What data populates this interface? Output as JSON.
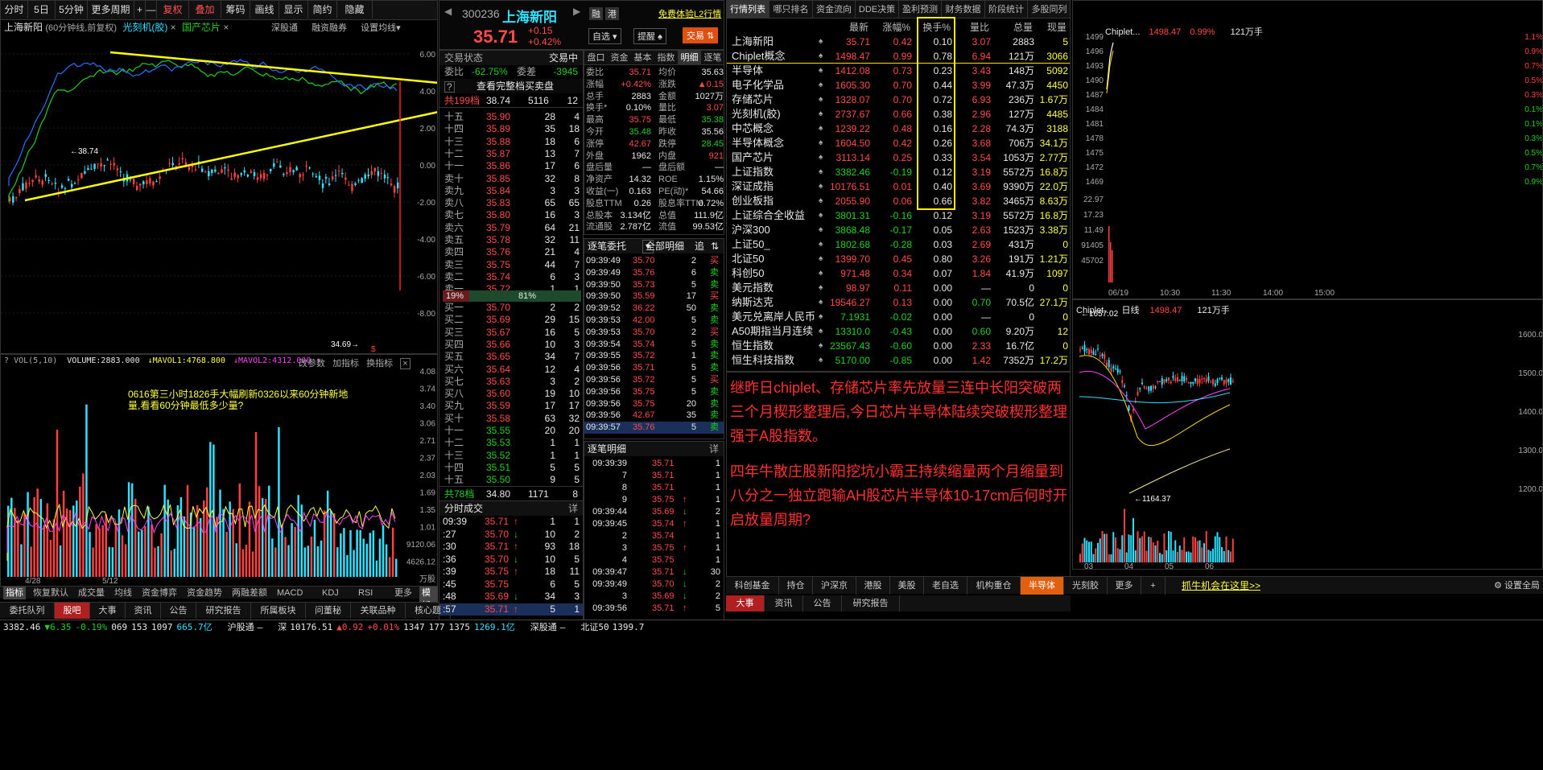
{
  "left_toolbar": {
    "items": [
      "分时",
      "5日",
      "5分钟",
      "更多周期",
      "+",
      "—",
      "复权",
      "叠加",
      "筹码",
      "画线",
      "显示",
      "简约",
      "隐藏"
    ]
  },
  "kline": {
    "stock_name": "上海新阳",
    "period_note": "(60分钟线,前复权)",
    "overlay1": "光刻机(胶)",
    "overlay2": "国产芯片",
    "actions": [
      "深股通",
      "融资融券",
      "设置均线"
    ],
    "y_axis_ticks": [
      "6.00",
      "4.00",
      "2.00",
      "0.00",
      "-2.00",
      "-4.00",
      "-6.00",
      "-8.00"
    ],
    "label_high": "38.74",
    "label_low": "34.69"
  },
  "volume": {
    "header_vol": "VOL(5,10)",
    "header_volume": "VOLUME:2883.000",
    "header_mavol1": "MAVOL1:4768.800",
    "header_mavol2": "MAVOL2:4312.000",
    "tools": [
      "改参数",
      "加指标",
      "换指标"
    ],
    "y_ticks": [
      "4.08",
      "3.74",
      "3.40",
      "3.06",
      "2.71",
      "2.37",
      "2.03",
      "1.69",
      "1.35",
      "1.01",
      "9120.06",
      "4626.12",
      "万股"
    ],
    "annotation": "0616第三小时1826手大幅刷新0326以来60分钟新地量,看看60分钟最低多少量?",
    "date1": "4/28",
    "date2": "5/12"
  },
  "left_bottom_tabs": [
    "指标",
    "恢复默认",
    "成交量",
    "均线",
    "资金博弈",
    "资金趋势",
    "两融差额",
    "MACD",
    "KDJ",
    "RSI",
    "更多",
    "模板"
  ],
  "quote": {
    "code": "300236",
    "name": "上海新阳",
    "price": "35.71",
    "change": "+0.15",
    "change_pct": "+0.42%",
    "badge1": "融",
    "badge2": "港",
    "l2_link": "免费体验L2行情",
    "btn_watch": "自选",
    "btn_alert": "提醒",
    "btn_trade": "交易",
    "status_label": "交易状态",
    "status_value": "交易中",
    "weibi_label": "委比",
    "weibi_value": "-62.75%",
    "weicha_label": "委差",
    "weicha_value": "-3945",
    "see_book": "查看完整档买卖盘",
    "sell_total_label": "共199档",
    "sell_total_price": "38.74",
    "sell_total_vol": "5116",
    "sell_total_cnt": "12",
    "ratio_left": "19%",
    "ratio_right": "81%",
    "buy_total_label": "共78档",
    "buy_total_price": "34.80",
    "buy_total_vol": "1171",
    "buy_total_cnt": "8"
  },
  "sell_book": [
    {
      "l": "十五",
      "p": "35.90",
      "v": "28",
      "n": "4"
    },
    {
      "l": "十四",
      "p": "35.89",
      "v": "35",
      "n": "18"
    },
    {
      "l": "十三",
      "p": "35.88",
      "v": "18",
      "n": "6"
    },
    {
      "l": "十二",
      "p": "35.87",
      "v": "13",
      "n": "7"
    },
    {
      "l": "十一",
      "p": "35.86",
      "v": "17",
      "n": "6"
    },
    {
      "l": "卖十",
      "p": "35.85",
      "v": "32",
      "n": "8"
    },
    {
      "l": "卖九",
      "p": "35.84",
      "v": "3",
      "n": "3"
    },
    {
      "l": "卖八",
      "p": "35.83",
      "v": "65",
      "n": "65"
    },
    {
      "l": "卖七",
      "p": "35.80",
      "v": "16",
      "n": "3"
    },
    {
      "l": "卖六",
      "p": "35.79",
      "v": "64",
      "n": "21"
    },
    {
      "l": "卖五",
      "p": "35.78",
      "v": "32",
      "n": "11"
    },
    {
      "l": "卖四",
      "p": "35.76",
      "v": "21",
      "n": "4"
    },
    {
      "l": "卖三",
      "p": "35.75",
      "v": "44",
      "n": "7"
    },
    {
      "l": "卖二",
      "p": "35.74",
      "v": "6",
      "n": "3"
    },
    {
      "l": "卖一",
      "p": "35.72",
      "v": "1",
      "n": "1"
    }
  ],
  "buy_book": [
    {
      "l": "买一",
      "p": "35.70",
      "v": "2",
      "n": "2"
    },
    {
      "l": "买二",
      "p": "35.69",
      "v": "29",
      "n": "15"
    },
    {
      "l": "买三",
      "p": "35.67",
      "v": "16",
      "n": "5"
    },
    {
      "l": "买四",
      "p": "35.66",
      "v": "10",
      "n": "3"
    },
    {
      "l": "买五",
      "p": "35.65",
      "v": "34",
      "n": "7"
    },
    {
      "l": "买六",
      "p": "35.64",
      "v": "12",
      "n": "4"
    },
    {
      "l": "买七",
      "p": "35.63",
      "v": "3",
      "n": "2"
    },
    {
      "l": "买八",
      "p": "35.60",
      "v": "19",
      "n": "10"
    },
    {
      "l": "买九",
      "p": "35.59",
      "v": "17",
      "n": "17"
    },
    {
      "l": "买十",
      "p": "35.58",
      "v": "63",
      "n": "32"
    },
    {
      "l": "十一",
      "p": "35.55",
      "v": "20",
      "n": "20"
    },
    {
      "l": "十二",
      "p": "35.53",
      "v": "1",
      "n": "1"
    },
    {
      "l": "十三",
      "p": "35.52",
      "v": "1",
      "n": "1"
    },
    {
      "l": "十四",
      "p": "35.51",
      "v": "5",
      "n": "5"
    },
    {
      "l": "十五",
      "p": "35.50",
      "v": "9",
      "n": "5"
    }
  ],
  "timeshare": {
    "title": "分时成交",
    "more": "详",
    "rows": [
      {
        "t": "09:39",
        "p": "35.71",
        "a": "↑",
        "v": "1",
        "n": "1"
      },
      {
        "t": ":27",
        "p": "35.70",
        "a": "↓",
        "v": "10",
        "n": "2"
      },
      {
        "t": ":30",
        "p": "35.71",
        "a": "↑",
        "v": "93",
        "n": "18"
      },
      {
        "t": ":36",
        "p": "35.70",
        "a": "↓",
        "v": "10",
        "n": "5"
      },
      {
        "t": ":39",
        "p": "35.75",
        "a": "↑",
        "v": "18",
        "n": "11"
      },
      {
        "t": ":45",
        "p": "35.75",
        "a": "",
        "v": "6",
        "n": "5"
      },
      {
        "t": ":48",
        "p": "35.69",
        "a": "↓",
        "v": "34",
        "n": "3"
      },
      {
        "t": ":57",
        "p": "35.71",
        "a": "↑",
        "v": "5",
        "n": "1"
      }
    ]
  },
  "detail_tabs": [
    "盘口",
    "资金",
    "基本",
    "指数",
    "明细",
    "逐笔"
  ],
  "detail": [
    {
      "l1": "委比",
      "v1": "35.71",
      "l2": "均价",
      "v2": "35.63"
    },
    {
      "l1": "涨幅",
      "v1": "+0.42%",
      "l2": "涨跌",
      "v2": "▲0.15"
    },
    {
      "l1": "总手",
      "v1": "2883",
      "l2": "金额",
      "v2": "1027万"
    },
    {
      "l1": "换手*",
      "v1": "0.10%",
      "l2": "量比",
      "v2": "3.07"
    },
    {
      "l1": "最高",
      "v1": "35.75",
      "l2": "最低",
      "v2": "35.38"
    },
    {
      "l1": "今开",
      "v1": "35.48",
      "l2": "昨收",
      "v2": "35.56"
    },
    {
      "l1": "涨停",
      "v1": "42.67",
      "l2": "跌停",
      "v2": "28.45"
    },
    {
      "l1": "外盘",
      "v1": "1962",
      "l2": "内盘",
      "v2": "921"
    },
    {
      "l1": "盘后量",
      "v1": "—",
      "l2": "盘后额",
      "v2": "—"
    },
    {
      "l1": "净资产",
      "v1": "14.32",
      "l2": "ROE",
      "v2": "1.15%"
    },
    {
      "l1": "收益(一)",
      "v1": "0.163",
      "l2": "PE(动)*",
      "v2": "54.66"
    },
    {
      "l1": "股息TTM",
      "v1": "0.26",
      "l2": "股息率TTM",
      "v2": "0.72%"
    },
    {
      "l1": "总股本",
      "v1": "3.134亿",
      "l2": "总值",
      "v2": "111.9亿"
    },
    {
      "l1": "流通股",
      "v1": "2.787亿",
      "l2": "流值",
      "v2": "99.53亿"
    }
  ],
  "ticks": {
    "title": "逐笔委托",
    "filter": "全部明细",
    "btn1": "追",
    "rows": [
      {
        "t": "09:39:49",
        "p": "35.70",
        "v": "2",
        "s": "买"
      },
      {
        "t": "09:39:49",
        "p": "35.76",
        "v": "6",
        "s": "卖"
      },
      {
        "t": "09:39:50",
        "p": "35.73",
        "v": "5",
        "s": "卖"
      },
      {
        "t": "09:39:50",
        "p": "35.59",
        "v": "17",
        "s": "买"
      },
      {
        "t": "09:39:52",
        "p": "36.22",
        "v": "50",
        "s": "卖"
      },
      {
        "t": "09:39:53",
        "p": "42.00",
        "v": "5",
        "s": "卖"
      },
      {
        "t": "09:39:53",
        "p": "35.70",
        "v": "2",
        "s": "买"
      },
      {
        "t": "09:39:54",
        "p": "35.74",
        "v": "5",
        "s": "卖"
      },
      {
        "t": "09:39:55",
        "p": "35.72",
        "v": "1",
        "s": "卖"
      },
      {
        "t": "09:39:56",
        "p": "35.71",
        "v": "5",
        "s": "卖"
      },
      {
        "t": "09:39:56",
        "p": "35.72",
        "v": "5",
        "s": "买"
      },
      {
        "t": "09:39:56",
        "p": "35.75",
        "v": "5",
        "s": "卖"
      },
      {
        "t": "09:39:56",
        "p": "35.75",
        "v": "20",
        "s": "卖"
      },
      {
        "t": "09:39:56",
        "p": "42.67",
        "v": "35",
        "s": "卖"
      },
      {
        "t": "09:39:57",
        "p": "35.76",
        "v": "5",
        "s": "卖"
      }
    ]
  },
  "deals": {
    "title": "逐笔明细",
    "more": "详",
    "rows": [
      {
        "t": "09:39:39",
        "p": "35.71",
        "a": "",
        "v": "1"
      },
      {
        "t": "7",
        "p": "35.71",
        "a": "",
        "v": "1"
      },
      {
        "t": "8",
        "p": "35.71",
        "a": "",
        "v": "1"
      },
      {
        "t": "9",
        "p": "35.75",
        "a": "↑",
        "v": "1"
      },
      {
        "t": "09:39:44",
        "p": "35.69",
        "a": "↓",
        "v": "2"
      },
      {
        "t": "09:39:45",
        "p": "35.74",
        "a": "↑",
        "v": "1"
      },
      {
        "t": "2",
        "p": "35.74",
        "a": "",
        "v": "1"
      },
      {
        "t": "3",
        "p": "35.75",
        "a": "↑",
        "v": "1"
      },
      {
        "t": "4",
        "p": "35.75",
        "a": "",
        "v": "1"
      },
      {
        "t": "09:39:47",
        "p": "35.71",
        "a": "↓",
        "v": "30"
      },
      {
        "t": "09:39:49",
        "p": "35.70",
        "a": "↓",
        "v": "2"
      },
      {
        "t": "3",
        "p": "35.69",
        "a": "↓",
        "v": "2"
      },
      {
        "t": "09:39:56",
        "p": "35.71",
        "a": "↑",
        "v": "5"
      }
    ]
  },
  "market_tabs": [
    "行情列表",
    "哪只排名",
    "资金流向",
    "DDE决策",
    "盈利预测",
    "财务数据",
    "阶段统计",
    "多股同列"
  ],
  "market_headers": [
    "最新",
    "涨幅%",
    "换手%",
    "量比",
    "总量",
    "现量"
  ],
  "market_rows": [
    {
      "n": "上海新阳",
      "p": "35.71",
      "c": "0.42",
      "t": "0.10",
      "q": "3.07",
      "v": "2883",
      "x": "5",
      "up": "r"
    },
    {
      "n": "Chiplet概念",
      "p": "1498.47",
      "c": "0.99",
      "t": "0.78",
      "q": "6.94",
      "v": "121万",
      "x": "3066",
      "up": "r"
    },
    {
      "n": "半导体",
      "p": "1412.08",
      "c": "0.73",
      "t": "0.23",
      "q": "3.43",
      "v": "148万",
      "x": "5092",
      "up": "r"
    },
    {
      "n": "电子化学品",
      "p": "1605.30",
      "c": "0.70",
      "t": "0.44",
      "q": "3.99",
      "v": "47.3万",
      "x": "4450",
      "up": "r"
    },
    {
      "n": "存储芯片",
      "p": "1328.07",
      "c": "0.70",
      "t": "0.72",
      "q": "6.93",
      "v": "236万",
      "x": "1.67万",
      "up": "r"
    },
    {
      "n": "光刻机(胶)",
      "p": "2737.67",
      "c": "0.66",
      "t": "0.38",
      "q": "2.96",
      "v": "127万",
      "x": "4485",
      "up": "r"
    },
    {
      "n": "中芯概念",
      "p": "1239.22",
      "c": "0.48",
      "t": "0.16",
      "q": "2.28",
      "v": "74.3万",
      "x": "3188",
      "up": "r"
    },
    {
      "n": "半导体概念",
      "p": "1604.50",
      "c": "0.42",
      "t": "0.26",
      "q": "3.68",
      "v": "706万",
      "x": "34.1万",
      "up": "r"
    },
    {
      "n": "国产芯片",
      "p": "3113.14",
      "c": "0.25",
      "t": "0.33",
      "q": "3.54",
      "v": "1053万",
      "x": "2.77万",
      "up": "r"
    },
    {
      "n": "上证指数",
      "p": "3382.46",
      "c": "-0.19",
      "t": "0.12",
      "q": "3.19",
      "v": "5572万",
      "x": "16.8万",
      "up": "g"
    },
    {
      "n": "深证成指",
      "p": "10176.51",
      "c": "0.01",
      "t": "0.40",
      "q": "3.69",
      "v": "9390万",
      "x": "22.0万",
      "up": "r"
    },
    {
      "n": "创业板指",
      "p": "2055.90",
      "c": "0.06",
      "t": "0.66",
      "q": "3.82",
      "v": "3465万",
      "x": "8.63万",
      "up": "r"
    },
    {
      "n": "上证综合全收益",
      "p": "3801.31",
      "c": "-0.16",
      "t": "0.12",
      "q": "3.19",
      "v": "5572万",
      "x": "16.8万",
      "up": "g"
    },
    {
      "n": "沪深300",
      "p": "3868.48",
      "c": "-0.17",
      "t": "0.05",
      "q": "2.63",
      "v": "1523万",
      "x": "3.38万",
      "up": "g"
    },
    {
      "n": "上证50_",
      "p": "1802.68",
      "c": "-0.28",
      "t": "0.03",
      "q": "2.69",
      "v": "431万",
      "x": "0",
      "up": "g"
    },
    {
      "n": "北证50",
      "p": "1399.70",
      "c": "0.45",
      "t": "0.80",
      "q": "3.26",
      "v": "191万",
      "x": "1.21万",
      "up": "r"
    },
    {
      "n": "科创50",
      "p": "971.48",
      "c": "0.34",
      "t": "0.07",
      "q": "1.84",
      "v": "41.9万",
      "x": "1097",
      "up": "r"
    },
    {
      "n": "美元指数",
      "p": "98.97",
      "c": "0.11",
      "t": "0.00",
      "q": "—",
      "v": "0",
      "x": "0",
      "up": "r"
    },
    {
      "n": "纳斯达克",
      "p": "19546.27",
      "c": "0.13",
      "t": "0.00",
      "q": "0.70",
      "v": "70.5亿",
      "x": "27.1万",
      "up": "r"
    },
    {
      "n": "美元兑离岸人民币",
      "p": "7.1931",
      "c": "-0.02",
      "t": "0.00",
      "q": "—",
      "v": "0",
      "x": "0",
      "up": "g"
    },
    {
      "n": "A50期指当月连续",
      "p": "13310.0",
      "c": "-0.43",
      "t": "0.00",
      "q": "0.60",
      "v": "9.20万",
      "x": "12",
      "up": "g"
    },
    {
      "n": "恒生指数",
      "p": "23567.43",
      "c": "-0.60",
      "t": "0.00",
      "q": "2.33",
      "v": "16.7亿",
      "x": "0",
      "up": "g"
    },
    {
      "n": "恒生科技指数",
      "p": "5170.00",
      "c": "-0.85",
      "t": "0.00",
      "q": "1.42",
      "v": "7352万",
      "x": "17.2万",
      "up": "g"
    }
  ],
  "commentary": {
    "p1": "继昨日chiplet、存储芯片率先放量三连中长阳突破两三个月楔形整理后,今日芯片半导体陆续突破楔形整理强于A股指数。",
    "p2": "四年牛散庄股新阳挖坑小霸王持续缩量两个月缩量到八分之一独立跑输AH股芯片半导体10-17cm后何时开启放量周期?"
  },
  "mini_top": {
    "name": "Chiplet...",
    "price": "1498.47",
    "pct": "0.99%",
    "vol": "121万手",
    "ticks_left": [
      "1499",
      "1496",
      "1493",
      "1490",
      "1487",
      "1484",
      "1481",
      "1478",
      "1475",
      "1472",
      "1469",
      "22.97",
      "17.23",
      "11.49",
      "91405",
      "45702"
    ],
    "ticks_right": [
      "1.1%",
      "0.9%",
      "0.7%",
      "0.5%",
      "0.3%",
      "0.1%",
      "0.1%",
      "0.3%",
      "0.5%",
      "0.7%",
      "0.9%"
    ],
    "times": [
      "06/19",
      "10:30",
      "11:30",
      "14:00",
      "15:00"
    ]
  },
  "mini_bottom": {
    "name": "Chiplet...",
    "period": "日线",
    "price": "1498.47",
    "vol": "121万手",
    "high_label": "1657.02",
    "low_label": "1164.37",
    "ticks": [
      "1600.0",
      "1500.0",
      "1400.0",
      "1300.0",
      "1200.0"
    ],
    "months": [
      "03",
      "04",
      "05",
      "06"
    ]
  },
  "bottom_tabs_mid": [
    "委托队列",
    "股吧",
    "大事",
    "资讯",
    "公告",
    "研究报告",
    "所属板块",
    "问董秘",
    "关联品种",
    "核心题"
  ],
  "bottom_tabs_right": [
    "科创基金",
    "持仓",
    "沪深京",
    "港股",
    "美股",
    "老自选",
    "机构重仓",
    "半导体",
    "光刻胶",
    "更多",
    "+"
  ],
  "bottom_tabs_right2": [
    "大事",
    "资讯",
    "公告",
    "研究报告"
  ],
  "promo": "抓牛机会在这里>>",
  "settings": "设置全局",
  "status_bar": [
    {
      "label": "",
      "v1": "3382.46",
      "v2": "▼6.35",
      "v3": "-0.19%",
      "v4": "069",
      "v5": "153",
      "v6": "1097",
      "v7": "665.7亿"
    },
    {
      "label": "沪股通",
      "v1": "—"
    },
    {
      "label": "深",
      "v1": "10176.51",
      "v2": "▲0.92",
      "v3": "+0.01%",
      "v4": "1347",
      "v5": "177",
      "v6": "1375",
      "v7": "1269.1亿"
    },
    {
      "label": "深股通",
      "v1": "—"
    },
    {
      "label": "北证50",
      "v1": "1399.7"
    }
  ]
}
